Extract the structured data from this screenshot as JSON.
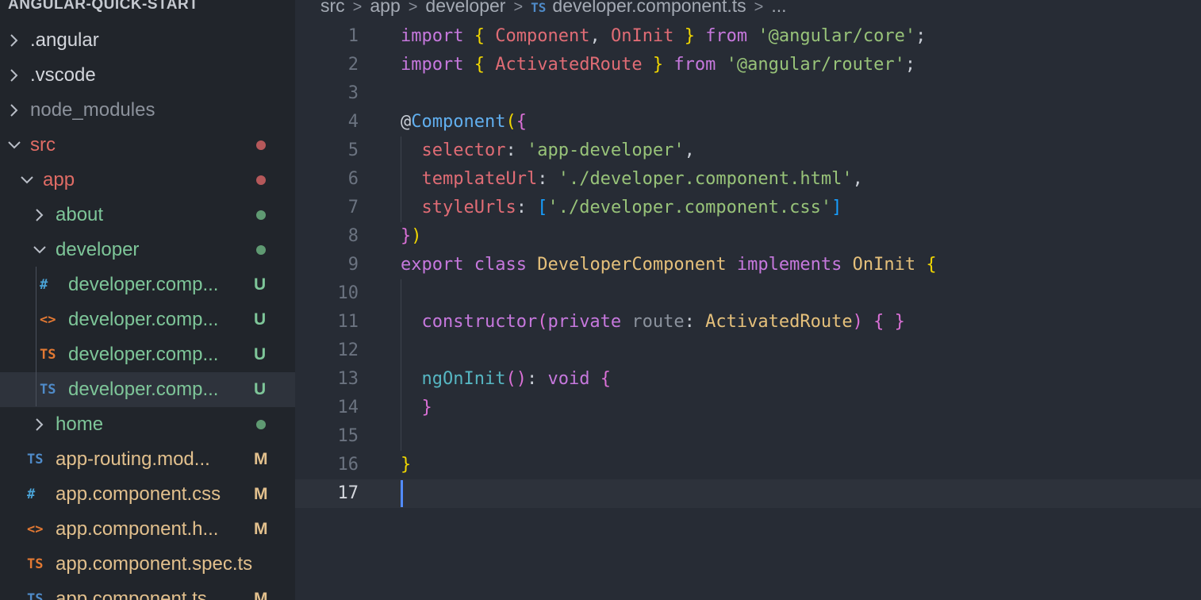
{
  "sidebar": {
    "project_title": "ANGULAR-QUICK-START",
    "items": [
      {
        "label": ".angular",
        "color": "#d3d6dc",
        "chevron": "right",
        "indent": 0,
        "icon": "",
        "icon_name": "",
        "status": ""
      },
      {
        "label": ".vscode",
        "color": "#d3d6dc",
        "chevron": "right",
        "indent": 0,
        "icon": "",
        "icon_name": "",
        "status": ""
      },
      {
        "label": "node_modules",
        "color": "#8c929c",
        "chevron": "right",
        "indent": 0,
        "icon": "",
        "icon_name": "",
        "status": ""
      },
      {
        "label": "src",
        "color": "#e06c65",
        "chevron": "down",
        "indent": 0,
        "icon": "",
        "icon_name": "",
        "status": "dot",
        "status_color": "#b5585a"
      },
      {
        "label": "app",
        "color": "#e06c65",
        "chevron": "down",
        "indent": 1,
        "icon": "",
        "icon_name": "",
        "status": "dot",
        "status_color": "#b5585a"
      },
      {
        "label": "about",
        "color": "#7ec699",
        "chevron": "right",
        "indent": 2,
        "icon": "",
        "icon_name": "",
        "status": "dot",
        "status_color": "#5f9a72"
      },
      {
        "label": "developer",
        "color": "#7ec699",
        "chevron": "down",
        "indent": 2,
        "icon": "",
        "icon_name": "",
        "status": "dot",
        "status_color": "#5f9a72"
      },
      {
        "label": "developer.comp...",
        "color": "#7ec699",
        "chevron": "",
        "indent": 3,
        "icon": "#",
        "icon_name": "css-file-icon",
        "icon_color": "#4aa3d6",
        "status": "U",
        "status_color": "#7ec699"
      },
      {
        "label": "developer.comp...",
        "color": "#7ec699",
        "chevron": "",
        "indent": 3,
        "icon": "<>",
        "icon_name": "html-file-icon",
        "icon_color": "#e37933",
        "status": "U",
        "status_color": "#7ec699"
      },
      {
        "label": "developer.comp...",
        "color": "#7ec699",
        "chevron": "",
        "indent": 3,
        "icon": "TS",
        "icon_name": "typescript-file-icon",
        "icon_color": "#e37933",
        "status": "U",
        "status_color": "#7ec699"
      },
      {
        "label": "developer.comp...",
        "color": "#7ec699",
        "chevron": "",
        "indent": 3,
        "icon": "TS",
        "icon_name": "typescript-file-icon",
        "icon_color": "#4f8bc9",
        "status": "U",
        "status_color": "#7ec699",
        "selected": true
      },
      {
        "label": "home",
        "color": "#7ec699",
        "chevron": "right",
        "indent": 2,
        "icon": "",
        "icon_name": "",
        "status": "dot",
        "status_color": "#5f9a72"
      },
      {
        "label": "app-routing.mod...",
        "color": "#e2c08d",
        "chevron": "",
        "indent": 2,
        "icon": "TS",
        "icon_name": "typescript-file-icon",
        "icon_color": "#4f8bc9",
        "status": "M",
        "status_color": "#e2c08d"
      },
      {
        "label": "app.component.css",
        "color": "#e2c08d",
        "chevron": "",
        "indent": 2,
        "icon": "#",
        "icon_name": "css-file-icon",
        "icon_color": "#4aa3d6",
        "status": "M",
        "status_color": "#e2c08d"
      },
      {
        "label": "app.component.h...",
        "color": "#e2c08d",
        "chevron": "",
        "indent": 2,
        "icon": "<>",
        "icon_name": "html-file-icon",
        "icon_color": "#e37933",
        "status": "M",
        "status_color": "#e2c08d"
      },
      {
        "label": "app.component.spec.ts",
        "color": "#e2c08d",
        "chevron": "",
        "indent": 2,
        "icon": "TS",
        "icon_name": "typescript-file-icon",
        "icon_color": "#e37933",
        "status": "",
        "status_color": ""
      },
      {
        "label": "app.component.ts",
        "color": "#e2c08d",
        "chevron": "",
        "indent": 2,
        "icon": "TS",
        "icon_name": "typescript-file-icon",
        "icon_color": "#4f8bc9",
        "status": "M",
        "status_color": "#e2c08d"
      }
    ]
  },
  "breadcrumb": {
    "parts": [
      "src",
      "app",
      "developer"
    ],
    "file_icon": "TS",
    "file": "developer.component.ts",
    "more": "..."
  },
  "editor": {
    "colors": {
      "keyword": "#c678dd",
      "brace_yellow": "#f1d700",
      "brace_pink": "#da70d6",
      "brace_blue": "#179fff",
      "type": "#e5c07b",
      "import_name": "#e06c75",
      "string": "#98c379",
      "property": "#e06c75",
      "function": "#61afef",
      "plain": "#c9ced6",
      "param": "#8b929d",
      "method": "#56b6c2"
    },
    "lines": [
      {
        "n": "1",
        "tokens": [
          [
            "import",
            "keyword"
          ],
          [
            " ",
            "plain"
          ],
          [
            "{",
            "brace_yellow"
          ],
          [
            " ",
            "plain"
          ],
          [
            "Component",
            "import_name"
          ],
          [
            ", ",
            "plain"
          ],
          [
            "OnInit",
            "import_name"
          ],
          [
            " ",
            "plain"
          ],
          [
            "}",
            "brace_yellow"
          ],
          [
            " ",
            "plain"
          ],
          [
            "from",
            "keyword"
          ],
          [
            " ",
            "plain"
          ],
          [
            "'@angular/core'",
            "string"
          ],
          [
            ";",
            "plain"
          ]
        ]
      },
      {
        "n": "2",
        "tokens": [
          [
            "import",
            "keyword"
          ],
          [
            " ",
            "plain"
          ],
          [
            "{",
            "brace_yellow"
          ],
          [
            " ",
            "plain"
          ],
          [
            "ActivatedRoute",
            "import_name"
          ],
          [
            " ",
            "plain"
          ],
          [
            "}",
            "brace_yellow"
          ],
          [
            " ",
            "plain"
          ],
          [
            "from",
            "keyword"
          ],
          [
            " ",
            "plain"
          ],
          [
            "'@angular/router'",
            "string"
          ],
          [
            ";",
            "plain"
          ]
        ]
      },
      {
        "n": "3",
        "tokens": []
      },
      {
        "n": "4",
        "tokens": [
          [
            "@",
            "plain"
          ],
          [
            "Component",
            "function"
          ],
          [
            "(",
            "brace_yellow"
          ],
          [
            "{",
            "brace_pink"
          ]
        ]
      },
      {
        "n": "5",
        "tokens": [
          [
            "  ",
            "plain"
          ],
          [
            "selector",
            "property"
          ],
          [
            ": ",
            "plain"
          ],
          [
            "'app-developer'",
            "string"
          ],
          [
            ",",
            "plain"
          ]
        ]
      },
      {
        "n": "6",
        "tokens": [
          [
            "  ",
            "plain"
          ],
          [
            "templateUrl",
            "property"
          ],
          [
            ": ",
            "plain"
          ],
          [
            "'./developer.component.html'",
            "string"
          ],
          [
            ",",
            "plain"
          ]
        ]
      },
      {
        "n": "7",
        "tokens": [
          [
            "  ",
            "plain"
          ],
          [
            "styleUrls",
            "property"
          ],
          [
            ": ",
            "plain"
          ],
          [
            "[",
            "brace_blue"
          ],
          [
            "'./developer.component.css'",
            "string"
          ],
          [
            "]",
            "brace_blue"
          ]
        ]
      },
      {
        "n": "8",
        "tokens": [
          [
            "}",
            "brace_pink"
          ],
          [
            ")",
            "brace_yellow"
          ]
        ]
      },
      {
        "n": "9",
        "tokens": [
          [
            "export",
            "keyword"
          ],
          [
            " ",
            "plain"
          ],
          [
            "class",
            "keyword"
          ],
          [
            " ",
            "plain"
          ],
          [
            "DeveloperComponent",
            "type"
          ],
          [
            " ",
            "plain"
          ],
          [
            "implements",
            "keyword"
          ],
          [
            " ",
            "plain"
          ],
          [
            "OnInit",
            "type"
          ],
          [
            " ",
            "plain"
          ],
          [
            "{",
            "brace_yellow"
          ]
        ]
      },
      {
        "n": "10",
        "tokens": []
      },
      {
        "n": "11",
        "tokens": [
          [
            "  ",
            "plain"
          ],
          [
            "constructor",
            "keyword"
          ],
          [
            "(",
            "brace_pink"
          ],
          [
            "private",
            "keyword"
          ],
          [
            " ",
            "plain"
          ],
          [
            "route",
            "param"
          ],
          [
            ": ",
            "plain"
          ],
          [
            "ActivatedRoute",
            "type"
          ],
          [
            ")",
            "brace_pink"
          ],
          [
            " ",
            "plain"
          ],
          [
            "{",
            "brace_pink"
          ],
          [
            " ",
            "plain"
          ],
          [
            "}",
            "brace_pink"
          ]
        ]
      },
      {
        "n": "12",
        "tokens": []
      },
      {
        "n": "13",
        "tokens": [
          [
            "  ",
            "plain"
          ],
          [
            "ngOnInit",
            "method"
          ],
          [
            "()",
            "brace_pink"
          ],
          [
            ": ",
            "plain"
          ],
          [
            "void",
            "keyword"
          ],
          [
            " ",
            "plain"
          ],
          [
            "{",
            "brace_pink"
          ]
        ]
      },
      {
        "n": "14",
        "tokens": [
          [
            "  ",
            "plain"
          ],
          [
            "}",
            "brace_pink"
          ]
        ]
      },
      {
        "n": "15",
        "tokens": []
      },
      {
        "n": "16",
        "tokens": [
          [
            "}",
            "brace_yellow"
          ]
        ]
      },
      {
        "n": "17",
        "tokens": [],
        "current": true
      }
    ]
  }
}
